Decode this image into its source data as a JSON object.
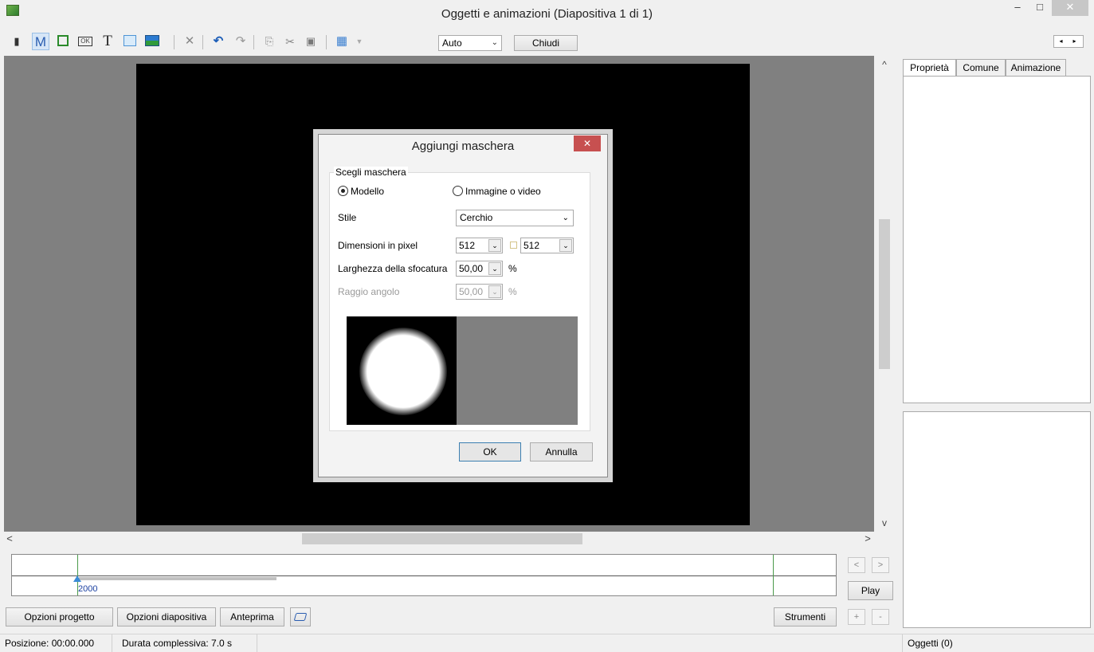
{
  "window": {
    "title": "Oggetti e animazioni  (Diapositiva 1 di 1)",
    "minimize": "–",
    "maximize": "□",
    "close": "✕"
  },
  "toolbar": {
    "zoom_value": "Auto",
    "close_label": "Chiudi",
    "items": [
      {
        "name": "camera-icon",
        "glyph": "🎥"
      },
      {
        "name": "mask-tool",
        "glyph": "M"
      },
      {
        "name": "frame-tool",
        "glyph": "◻"
      },
      {
        "name": "ok-button-tool",
        "glyph": "OK"
      },
      {
        "name": "text-tool",
        "glyph": "T"
      },
      {
        "name": "rectangle-tool",
        "glyph": "■"
      },
      {
        "name": "image-tool",
        "glyph": "▆"
      },
      {
        "name": "delete-icon",
        "glyph": "✕"
      },
      {
        "name": "undo-icon",
        "glyph": "↶"
      },
      {
        "name": "redo-icon",
        "glyph": "↷"
      },
      {
        "name": "copy-icon",
        "glyph": "⎘"
      },
      {
        "name": "cut-icon",
        "glyph": "✂"
      },
      {
        "name": "paste-icon",
        "glyph": "📋"
      },
      {
        "name": "grid-icon",
        "glyph": "▦"
      }
    ]
  },
  "dialog": {
    "title": "Aggiungi maschera",
    "close": "✕",
    "group_label": "Scegli maschera",
    "radio_template": "Modello",
    "radio_image": "Immagine o video",
    "style_label": "Stile",
    "style_value": "Cerchio",
    "size_label": "Dimensioni in pixel",
    "size_width": "512",
    "size_height": "512",
    "blur_label": "Larghezza della sfocatura",
    "blur_value": "50,00",
    "blur_unit": "%",
    "radius_label": "Raggio angolo",
    "radius_value": "50,00",
    "radius_unit": "%",
    "ok_label": "OK",
    "cancel_label": "Annulla"
  },
  "right_panel": {
    "tabs": [
      "Proprietà",
      "Comune",
      "Animazione"
    ]
  },
  "timeline": {
    "marker_label": "2000",
    "prev": "<",
    "next": ">",
    "play_label": "Play",
    "plus": "+",
    "minus": "-"
  },
  "bottom": {
    "project_options": "Opzioni progetto",
    "slide_options": "Opzioni diapositiva",
    "preview": "Anteprima",
    "tools": "Strumenti"
  },
  "status": {
    "position": "Posizione:  00:00.000",
    "duration": "Durata complessiva:  7.0 s",
    "objects": "Oggetti (0)"
  },
  "scroll": {
    "up": "^",
    "down": "v",
    "left": "<",
    "right": ">"
  }
}
